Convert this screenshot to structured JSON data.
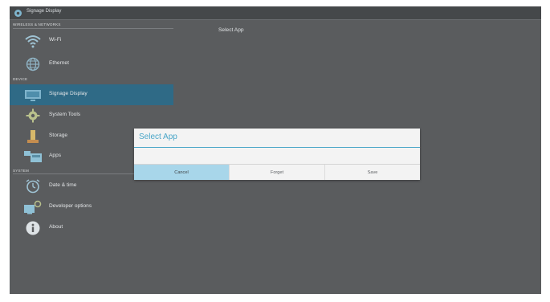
{
  "window": {
    "title": "Signage Display"
  },
  "sidebar": {
    "sections": {
      "wireless": "WIRELESS & NETWORKS",
      "device": "DEVICE",
      "system": "SYSTEM"
    },
    "items": [
      {
        "label": "Wi-Fi",
        "icon": "wifi-icon"
      },
      {
        "label": "Ethernet",
        "icon": "ethernet-icon"
      },
      {
        "label": "Signage Display",
        "icon": "display-icon",
        "selected": true
      },
      {
        "label": "System Tools",
        "icon": "gear-icon"
      },
      {
        "label": "Storage",
        "icon": "storage-icon"
      },
      {
        "label": "Apps",
        "icon": "apps-icon"
      },
      {
        "label": "Date & time",
        "icon": "clock-icon"
      },
      {
        "label": "Developer options",
        "icon": "developer-icon"
      },
      {
        "label": "About",
        "icon": "info-icon"
      }
    ]
  },
  "content": {
    "header": "Select App"
  },
  "dialog": {
    "title": "Select App",
    "buttons": {
      "cancel": "Cancel",
      "forget": "Forget",
      "save": "Save"
    }
  },
  "colors": {
    "background": "#5a5c5e",
    "selected": "#2f6a86",
    "accent": "#4aa6c8",
    "focused_button": "#a8d6ea"
  }
}
